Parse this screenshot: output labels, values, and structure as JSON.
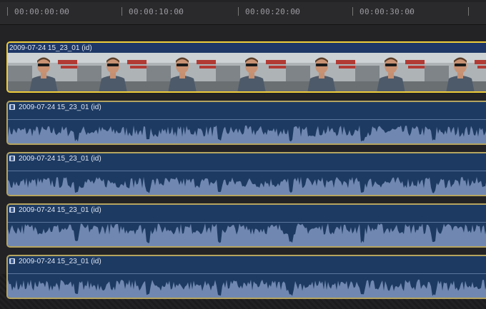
{
  "ruler": {
    "timecodes": [
      "00:00:00:00",
      "00:00:10:00",
      "00:00:20:00",
      "00:00:30:00"
    ]
  },
  "video_clip": {
    "title": "2009-07-24 15_23_01 (id)"
  },
  "audio_clips": [
    {
      "title": "2009-07-24 15_23_01 (id)"
    },
    {
      "title": "2009-07-24 15_23_01 (id)"
    },
    {
      "title": "2009-07-24 15_23_01 (id)"
    },
    {
      "title": "2009-07-24 15_23_01 (id)"
    }
  ],
  "icons": {
    "audio_clip_icon": "film-icon"
  },
  "colors": {
    "selected_border": "#f0cd3a",
    "clip_border": "#b6a560",
    "audio_fill": "#1d3a62",
    "waveform": "#7f97bf"
  }
}
